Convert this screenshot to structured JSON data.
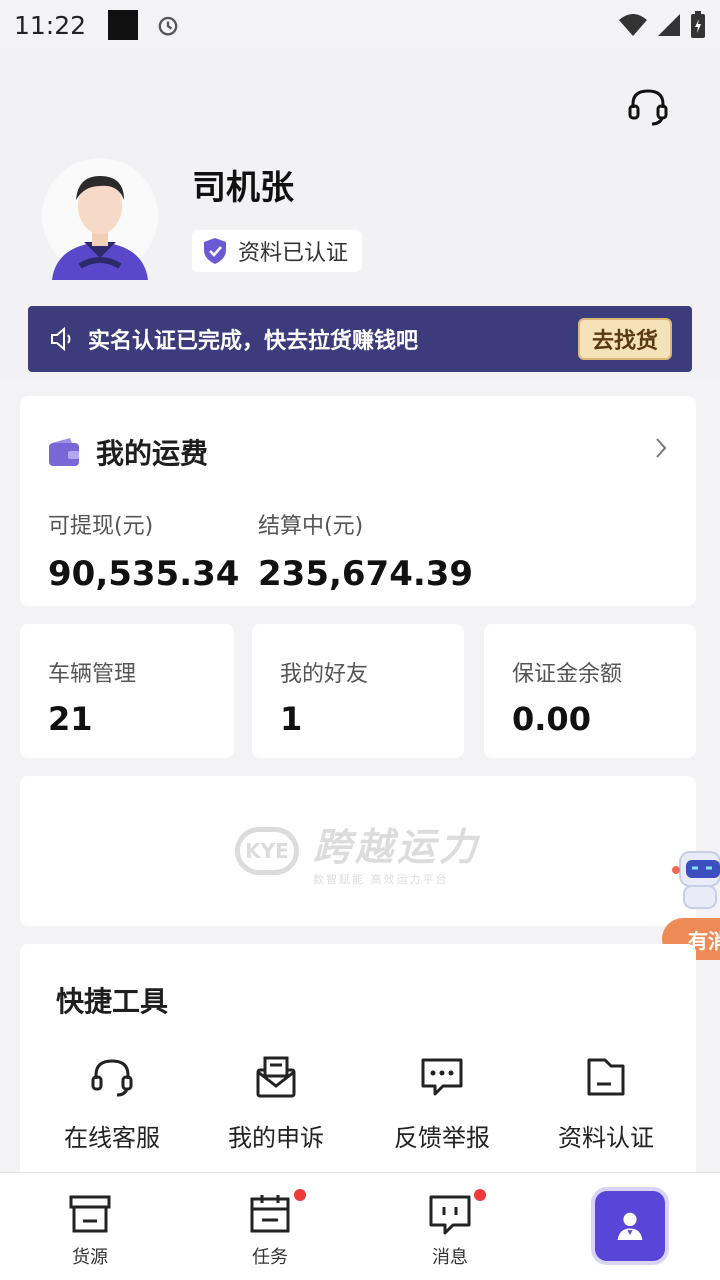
{
  "status_bar": {
    "time": "11:22"
  },
  "profile": {
    "name": "司机张",
    "verified_label": "资料已认证"
  },
  "banner": {
    "text": "实名认证已完成，快去拉货赚钱吧",
    "button_label": "去找货"
  },
  "freight": {
    "title": "我的运费",
    "withdrawable_label": "可提现(元)",
    "withdrawable_value": "90,535.34",
    "settling_label": "结算中(元)",
    "settling_value": "235,674.39"
  },
  "stats": [
    {
      "label": "车辆管理",
      "value": "21"
    },
    {
      "label": "我的好友",
      "value": "1"
    },
    {
      "label": "保证金余额",
      "value": "0.00"
    }
  ],
  "logo": {
    "mark": "KYE",
    "name": "跨越运力",
    "tagline": "数智赋能 高效运力平台"
  },
  "float_pill": {
    "text": "有消"
  },
  "tools": {
    "title": "快捷工具",
    "items": [
      {
        "label": "在线客服",
        "icon": "headset-icon"
      },
      {
        "label": "我的申诉",
        "icon": "mail-icon"
      },
      {
        "label": "反馈举报",
        "icon": "chat-icon"
      },
      {
        "label": "资料认证",
        "icon": "folder-icon"
      }
    ]
  },
  "bottom_nav": [
    {
      "label": "货源",
      "icon": "box-icon"
    },
    {
      "label": "任务",
      "icon": "calendar-icon"
    },
    {
      "label": "消息",
      "icon": "message-icon"
    },
    {
      "label": "",
      "icon": "person-icon"
    }
  ],
  "colors": {
    "primary": "#5946d8",
    "banner_bg": "#3c3c7c",
    "pill": "#ee8a55",
    "badge_dot": "#ee3a3a"
  }
}
